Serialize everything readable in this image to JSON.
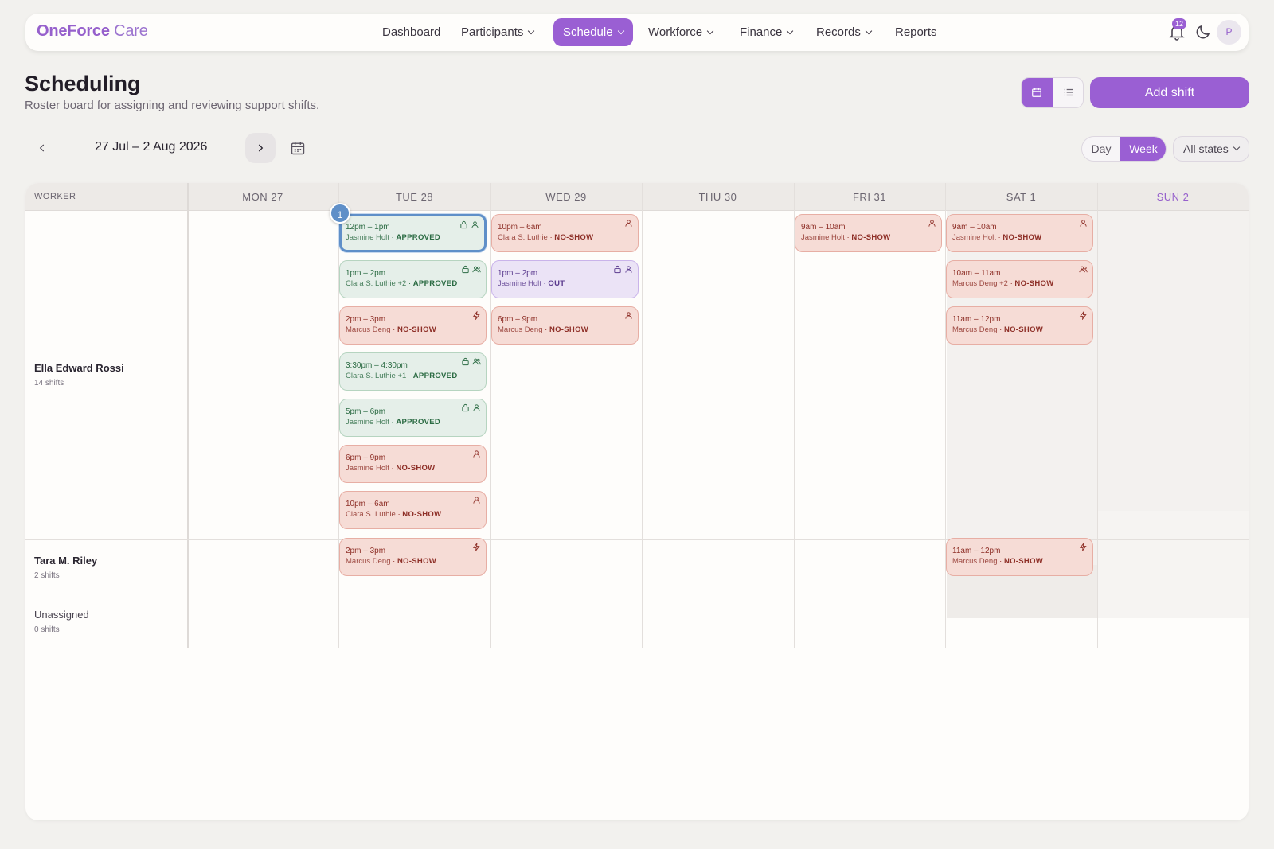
{
  "brand": {
    "name": "OneForce",
    "suffix": " Care"
  },
  "nav": [
    {
      "label": "Dashboard",
      "dropdown": false
    },
    {
      "label": "Participants",
      "dropdown": true
    },
    {
      "label": "Schedule",
      "dropdown": true,
      "active": true
    },
    {
      "label": "Workforce",
      "dropdown": true
    },
    {
      "label": "Finance",
      "dropdown": true
    },
    {
      "label": "Records",
      "dropdown": true
    },
    {
      "label": "Reports",
      "dropdown": false
    }
  ],
  "notifications": {
    "count": "12"
  },
  "user": {
    "initial": "P"
  },
  "page": {
    "title": "Scheduling",
    "subtitle": "Roster board for assigning and reviewing support shifts."
  },
  "actions": {
    "add_shift": "Add shift",
    "view": "calendar"
  },
  "range": {
    "label": "27 Jul – 2 Aug 2026"
  },
  "view_mode": {
    "day": "Day",
    "week": "Week",
    "selected": "Week"
  },
  "state_filter": {
    "value": "All states"
  },
  "board": {
    "worker_header": "WORKER",
    "days": [
      "MON 27",
      "TUE 28",
      "WED 29",
      "THU 30",
      "FRI 31",
      "SAT 1",
      "SUN 2"
    ],
    "workers": [
      {
        "name": "Ella Edward Rossi",
        "count": "14 shifts"
      },
      {
        "name": "Tara M. Riley",
        "count": "2 shifts"
      },
      {
        "name": "Unassigned",
        "count": "0 shifts"
      }
    ]
  },
  "selected_marker": "1",
  "colors": {
    "accent": "#9a5fd3",
    "no_show": "#f6dcd6",
    "approved": "#e5efe9",
    "out": "#ebe3f6",
    "selected": "#5f8fc8"
  },
  "shifts": [
    {
      "row": 0,
      "day": 1,
      "slot": 0,
      "time": "12pm – 1pm",
      "who": "Jasmine Holt",
      "status": "APPROVED",
      "tone": "green",
      "icons": [
        "lock-icon",
        "person-icon"
      ],
      "selected": true
    },
    {
      "row": 0,
      "day": 1,
      "slot": 1,
      "time": "1pm – 2pm",
      "who": "Clara S. Luthie +2",
      "status": "APPROVED",
      "tone": "green",
      "icons": [
        "lock-icon",
        "people-icon"
      ]
    },
    {
      "row": 0,
      "day": 1,
      "slot": 2,
      "time": "2pm – 3pm",
      "who": "Marcus Deng",
      "status": "NO-SHOW",
      "tone": "red",
      "icons": [
        "bolt-icon"
      ]
    },
    {
      "row": 0,
      "day": 1,
      "slot": 3,
      "time": "3:30pm – 4:30pm",
      "who": "Clara S. Luthie +1",
      "status": "APPROVED",
      "tone": "green",
      "icons": [
        "lock-icon",
        "people-icon"
      ]
    },
    {
      "row": 0,
      "day": 1,
      "slot": 4,
      "time": "5pm – 6pm",
      "who": "Jasmine Holt",
      "status": "APPROVED",
      "tone": "green",
      "icons": [
        "lock-icon",
        "person-icon"
      ]
    },
    {
      "row": 0,
      "day": 1,
      "slot": 5,
      "time": "6pm – 9pm",
      "who": "Jasmine Holt",
      "status": "NO-SHOW",
      "tone": "red",
      "icons": [
        "person-icon"
      ]
    },
    {
      "row": 0,
      "day": 1,
      "slot": 6,
      "time": "10pm – 6am",
      "who": "Clara S. Luthie",
      "status": "NO-SHOW",
      "tone": "red",
      "icons": [
        "person-icon"
      ]
    },
    {
      "row": 0,
      "day": 2,
      "slot": 0,
      "time": "10pm – 6am",
      "who": "Clara S. Luthie",
      "status": "NO-SHOW",
      "tone": "red",
      "icons": [
        "person-icon"
      ]
    },
    {
      "row": 0,
      "day": 2,
      "slot": 1,
      "time": "1pm – 2pm",
      "who": "Jasmine Holt",
      "status": "OUT",
      "tone": "purple",
      "icons": [
        "lock-icon",
        "person-icon"
      ]
    },
    {
      "row": 0,
      "day": 2,
      "slot": 2,
      "time": "6pm – 9pm",
      "who": "Marcus Deng",
      "status": "NO-SHOW",
      "tone": "red",
      "icons": [
        "person-icon"
      ]
    },
    {
      "row": 0,
      "day": 4,
      "slot": 0,
      "time": "9am – 10am",
      "who": "Jasmine Holt",
      "status": "NO-SHOW",
      "tone": "red",
      "icons": [
        "person-icon"
      ]
    },
    {
      "row": 0,
      "day": 5,
      "slot": 0,
      "time": "9am – 10am",
      "who": "Jasmine Holt",
      "status": "NO-SHOW",
      "tone": "red",
      "icons": [
        "person-icon"
      ]
    },
    {
      "row": 0,
      "day": 5,
      "slot": 1,
      "time": "10am – 11am",
      "who": "Marcus Deng +2",
      "status": "NO-SHOW",
      "tone": "red",
      "icons": [
        "people-icon"
      ]
    },
    {
      "row": 0,
      "day": 5,
      "slot": 2,
      "time": "11am – 12pm",
      "who": "Marcus Deng",
      "status": "NO-SHOW",
      "tone": "red",
      "icons": [
        "bolt-icon"
      ]
    },
    {
      "row": 1,
      "day": 1,
      "slot": 0,
      "time": "2pm – 3pm",
      "who": "Marcus Deng",
      "status": "NO-SHOW",
      "tone": "red",
      "icons": [
        "bolt-icon"
      ]
    },
    {
      "row": 1,
      "day": 5,
      "slot": 0,
      "time": "11am – 12pm",
      "who": "Marcus Deng",
      "status": "NO-SHOW",
      "tone": "red",
      "icons": [
        "bolt-icon"
      ]
    }
  ]
}
